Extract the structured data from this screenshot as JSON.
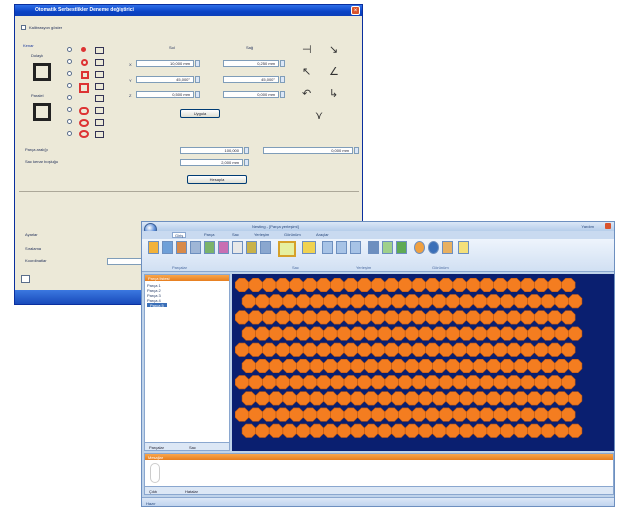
{
  "dialog": {
    "title": "Otomatik Serbestlikler Deneme değiştirici",
    "close_glyph": "×",
    "top_checkbox_label": "Kalibrasyon göster",
    "section_edge": "Kenar",
    "label_top": "Dolaylı",
    "label_bottom": "Paralel",
    "col_left": "Sol",
    "col_right": "Sağ",
    "row_labels": [
      "X",
      "Y",
      "Z"
    ],
    "values_left": [
      "10,000 mm",
      "45,000°",
      "0,500 mm"
    ],
    "values_right": [
      "0,250 mm",
      "45,000°",
      "0,000 mm"
    ],
    "apply_button": "Uygula",
    "part_spacing_label": "Parça aralığı",
    "part_spacing_value": "100,000",
    "part_spacing_right": "0,000 mm",
    "sheet_margin_label": "Sac kenar boşluğu",
    "sheet_margin_value": "2,000 mm",
    "calc_button": "Hesapla",
    "settings_label": "Ayarlar",
    "order_label": "Sıralama",
    "coords_label": "Koordinatlar"
  },
  "app": {
    "title": "Nesting - [Parça yerleşimi]",
    "tabs": [
      "Giriş",
      "Parça",
      "Sac",
      "Yerleşim",
      "Görünüm",
      "Araçlar"
    ],
    "help_label": "Yardım",
    "ribbon_groups": [
      "Parçalar",
      "Sac",
      "Yerleşim",
      "Görünüm"
    ],
    "left_pane": {
      "title": "Parça listesi",
      "items": [
        "Parça 1",
        "Parça 2",
        "Parça 3",
        "Parça 4",
        "Parça 5"
      ],
      "tabs": [
        "Parçalar",
        "Sac"
      ]
    },
    "bottom_pane": {
      "title": "Mesajlar",
      "tabs": [
        "Çıktı",
        "Hatalar"
      ]
    },
    "status": "Hazır",
    "colors": {
      "part_fill": "#f47d20",
      "canvas_bg": "#0a1f70",
      "accent": "#e67e1f"
    },
    "nest": {
      "rows": 10,
      "cols": 25
    }
  }
}
